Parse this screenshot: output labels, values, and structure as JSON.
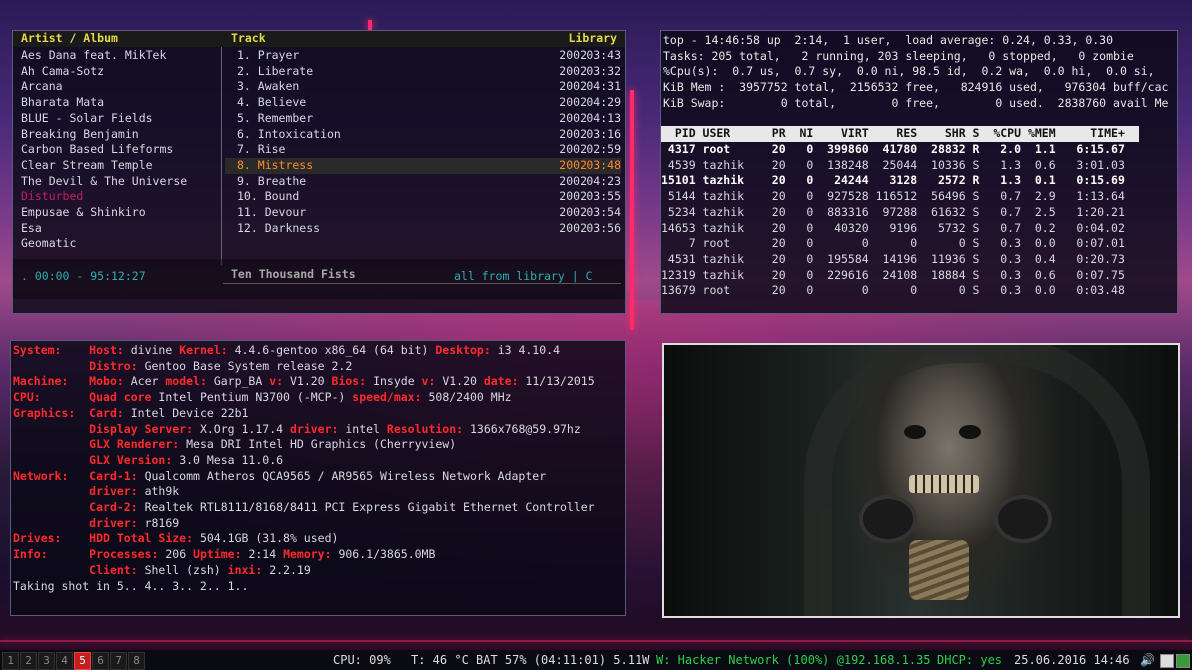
{
  "cmus": {
    "header": {
      "left": "Artist / Album",
      "mid": "Track",
      "right": "Library"
    },
    "artists": [
      "Aes Dana feat. MikTek",
      "Ah Cama-Sotz",
      "Arcana",
      "Bharata Mata",
      "BLUE - Solar Fields",
      "Breaking Benjamin",
      "Carbon Based Lifeforms",
      "Clear Stream Temple",
      "The Devil & The Universe",
      "Disturbed",
      "Empusae & Shinkiro",
      "Esa",
      "Geomatic"
    ],
    "tracks": [
      {
        "n": "1. Prayer",
        "y": "2002",
        "t": "03:43"
      },
      {
        "n": "2. Liberate",
        "y": "2002",
        "t": "03:32"
      },
      {
        "n": "3. Awaken",
        "y": "2002",
        "t": "04:31"
      },
      {
        "n": "4. Believe",
        "y": "2002",
        "t": "04:29"
      },
      {
        "n": "5. Remember",
        "y": "2002",
        "t": "04:13"
      },
      {
        "n": "6. Intoxication",
        "y": "2002",
        "t": "03:16"
      },
      {
        "n": "7. Rise",
        "y": "2002",
        "t": "02:59"
      },
      {
        "n": "8. Mistress",
        "y": "2002",
        "t": "03:48"
      },
      {
        "n": "9. Breathe",
        "y": "2002",
        "t": "04:23"
      },
      {
        "n": "10. Bound",
        "y": "2002",
        "t": "03:55"
      },
      {
        "n": "11. Devour",
        "y": "2002",
        "t": "03:54"
      },
      {
        "n": "12. Darkness",
        "y": "2002",
        "t": "03:56"
      }
    ],
    "album_next": "Ten Thousand Fists",
    "status_left": ". 00:00 - 95:12:27",
    "status_right": "all from library | C"
  },
  "top": {
    "lines": [
      "top - 14:46:58 up  2:14,  1 user,  load average: 0.24, 0.33, 0.30",
      "Tasks: 205 total,   2 running, 203 sleeping,   0 stopped,   0 zombie",
      "%Cpu(s):  0.7 us,  0.7 sy,  0.0 ni, 98.5 id,  0.2 wa,  0.0 hi,  0.0 si,",
      "KiB Mem :  3957752 total,  2156532 free,   824916 used,   976304 buff/cac",
      "KiB Swap:        0 total,        0 free,        0 used.  2838760 avail Me"
    ],
    "header": "  PID USER      PR  NI    VIRT    RES    SHR S  %CPU %MEM     TIME+",
    "procs": [
      " 4317 root      20   0  399860  41780  28832 R   2.0  1.1   6:15.67",
      " 4539 tazhik    20   0  138248  25044  10336 S   1.3  0.6   3:01.03",
      "15101 tazhik    20   0   24244   3128   2572 R   1.3  0.1   0:15.69",
      " 5144 tazhik    20   0  927528 116512  56496 S   0.7  2.9   1:13.64",
      " 5234 tazhik    20   0  883316  97288  61632 S   0.7  2.5   1:20.21",
      "14653 tazhik    20   0   40320   9196   5732 S   0.7  0.2   0:04.02",
      "    7 root      20   0       0      0      0 S   0.3  0.0   0:07.01",
      " 4531 tazhik    20   0  195584  14196  11936 S   0.3  0.4   0:20.73",
      "12319 tazhik    20   0  229616  24108  18884 S   0.3  0.6   0:07.75",
      "13679 root      20   0       0      0      0 S   0.3  0.0   0:03.48"
    ]
  },
  "inxi": {
    "lines": [
      [
        [
          "System:    ",
          "r"
        ],
        [
          "Host: ",
          "r"
        ],
        [
          "divine ",
          ""
        ],
        [
          "Kernel: ",
          "r"
        ],
        [
          "4.4.6-gentoo x86_64 (64 bit) ",
          ""
        ],
        [
          "Desktop: ",
          "r"
        ],
        [
          "i3 4.10.4",
          ""
        ]
      ],
      [
        [
          "           ",
          ""
        ],
        [
          "Distro: ",
          "r"
        ],
        [
          "Gentoo Base System release 2.2",
          ""
        ]
      ],
      [
        [
          "Machine:   ",
          "r"
        ],
        [
          "Mobo: ",
          "r"
        ],
        [
          "Acer ",
          ""
        ],
        [
          "model: ",
          "r"
        ],
        [
          "Garp_BA ",
          ""
        ],
        [
          "v: ",
          "r"
        ],
        [
          "V1.20 ",
          ""
        ],
        [
          "Bios: ",
          "r"
        ],
        [
          "Insyde ",
          ""
        ],
        [
          "v: ",
          "r"
        ],
        [
          "V1.20 ",
          ""
        ],
        [
          "date: ",
          "r"
        ],
        [
          "11/13/2015",
          ""
        ]
      ],
      [
        [
          "CPU:       ",
          "r"
        ],
        [
          "Quad core ",
          "r"
        ],
        [
          "Intel Pentium N3700 (-MCP-) ",
          ""
        ],
        [
          "speed/max: ",
          "r"
        ],
        [
          "508/2400 MHz",
          ""
        ]
      ],
      [
        [
          "Graphics:  ",
          "r"
        ],
        [
          "Card: ",
          "r"
        ],
        [
          "Intel Device 22b1",
          ""
        ]
      ],
      [
        [
          "           ",
          ""
        ],
        [
          "Display Server: ",
          "r"
        ],
        [
          "X.Org 1.17.4 ",
          ""
        ],
        [
          "driver: ",
          "r"
        ],
        [
          "intel ",
          ""
        ],
        [
          "Resolution: ",
          "r"
        ],
        [
          "1366x768@59.97hz",
          ""
        ]
      ],
      [
        [
          "           ",
          ""
        ],
        [
          "GLX Renderer: ",
          "r"
        ],
        [
          "Mesa DRI Intel HD Graphics (Cherryview)",
          ""
        ]
      ],
      [
        [
          "           ",
          ""
        ],
        [
          "GLX Version: ",
          "r"
        ],
        [
          "3.0 Mesa 11.0.6",
          ""
        ]
      ],
      [
        [
          "Network:   ",
          "r"
        ],
        [
          "Card-1: ",
          "r"
        ],
        [
          "Qualcomm Atheros QCA9565 / AR9565 Wireless Network Adapter",
          ""
        ]
      ],
      [
        [
          "           ",
          ""
        ],
        [
          "driver: ",
          "r"
        ],
        [
          "ath9k",
          ""
        ]
      ],
      [
        [
          "           ",
          ""
        ],
        [
          "Card-2: ",
          "r"
        ],
        [
          "Realtek RTL8111/8168/8411 PCI Express Gigabit Ethernet Controller",
          ""
        ]
      ],
      [
        [
          "           ",
          ""
        ],
        [
          "driver: ",
          "r"
        ],
        [
          "r8169",
          ""
        ]
      ],
      [
        [
          "Drives:    ",
          "r"
        ],
        [
          "HDD Total Size: ",
          "r"
        ],
        [
          "504.1GB (31.8% used)",
          ""
        ]
      ],
      [
        [
          "Info:      ",
          "r"
        ],
        [
          "Processes: ",
          "r"
        ],
        [
          "206 ",
          ""
        ],
        [
          "Uptime: ",
          "r"
        ],
        [
          "2:14 ",
          ""
        ],
        [
          "Memory: ",
          "r"
        ],
        [
          "906.1/3865.0MB",
          ""
        ]
      ],
      [
        [
          "           ",
          ""
        ],
        [
          "Client: ",
          "r"
        ],
        [
          "Shell (zsh) ",
          ""
        ],
        [
          "inxi: ",
          "r"
        ],
        [
          "2.2.19",
          ""
        ]
      ],
      [
        [
          "Taking shot in 5.. 4.. 3.. 2.. 1..",
          ""
        ]
      ]
    ]
  },
  "bar": {
    "workspaces": [
      "1",
      "2",
      "3",
      "4",
      "5",
      "6",
      "7",
      "8"
    ],
    "active": "5",
    "cpu": "CPU: 09%",
    "temp": "T: 46 °C",
    "bat": "BAT 57% (04:11:01) 5.11W",
    "wifi": "W: Hacker Network (100%) @192.168.1.35",
    "dhcp": "DHCP: yes",
    "date": "25.06.2016 14:46"
  },
  "colors": {
    "accent": "#ff2a6a",
    "cmus_header": "#e6d84a",
    "playing": "#ff8a2a",
    "label_red": "#ff2a2a",
    "cyan": "#2ab0b0"
  }
}
